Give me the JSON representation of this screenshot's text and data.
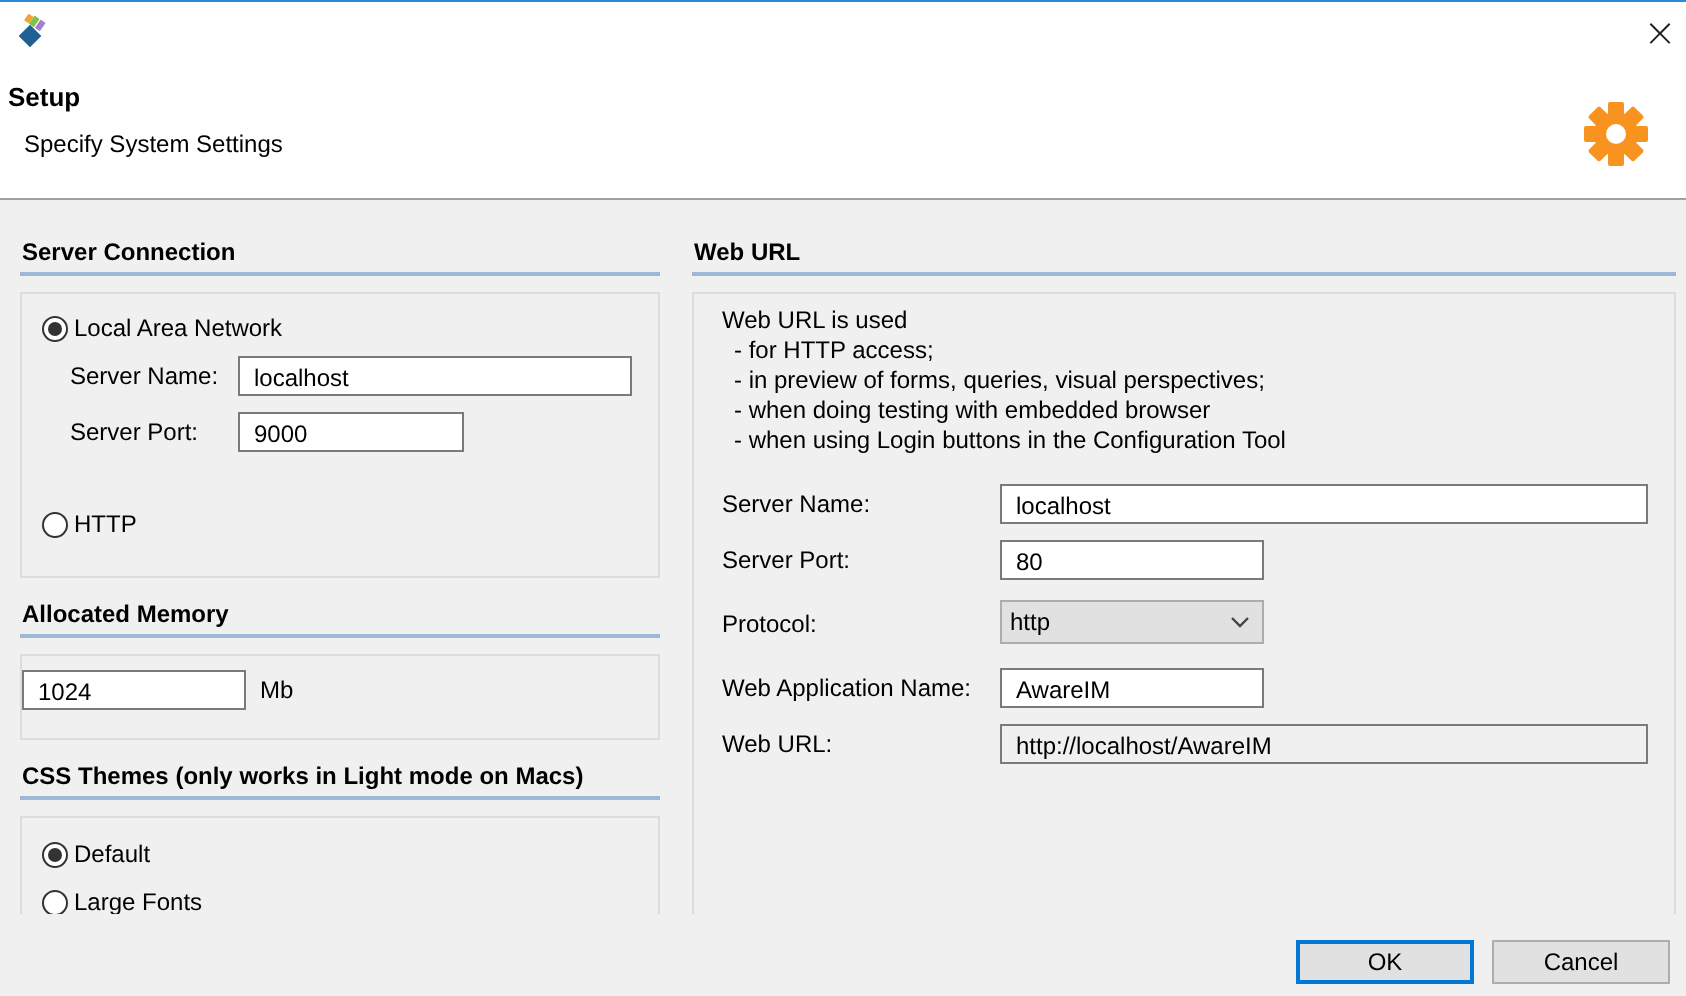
{
  "window": {
    "close": "×"
  },
  "header": {
    "title": "Setup",
    "subtitle": "Specify System Settings"
  },
  "left_sections": [
    {
      "title": "Server Connection",
      "items": [
        {
          "kind": "radio",
          "label": "Local Area Network",
          "selected": true
        },
        {
          "kind": "field",
          "label": "Server Name:",
          "value": "localhost"
        },
        {
          "kind": "short_field",
          "label": "Server Port:",
          "value": "9000"
        },
        {
          "kind": "radio",
          "label": "HTTP",
          "selected": false
        }
      ]
    },
    {
      "title": "Allocated Memory",
      "items": [
        {
          "kind": "unit_field",
          "value": "1024",
          "unit": "Mb"
        }
      ]
    },
    {
      "title": "CSS Themes (only works in Light mode on Macs)",
      "items": [
        {
          "kind": "radio",
          "label": "Default",
          "selected": true
        },
        {
          "kind": "radio",
          "label": "Large Fonts",
          "selected": false
        }
      ]
    }
  ],
  "right_sections": [
    {
      "title": "Web URL",
      "note": [
        "Web URL is used",
        "- for HTTP access;",
        "- in preview of forms, queries, visual perspectives;",
        "- when doing testing with embedded browser",
        "- when using Login buttons in the Configuration Tool"
      ],
      "items": [
        {
          "kind": "field",
          "label": "Server Name:",
          "value": "localhost"
        },
        {
          "kind": "short_field",
          "label": "Server Port:",
          "value": "80"
        },
        {
          "kind": "select",
          "label": "Protocol:",
          "value": "http"
        },
        {
          "kind": "short_field",
          "label": "Web Application Name:",
          "value": "AwareIM"
        },
        {
          "kind": "readonly_field",
          "label": "Web URL:",
          "value": "http://localhost/AwareIM"
        }
      ]
    }
  ],
  "buttons": [
    {
      "label": "OK",
      "default": true
    },
    {
      "label": "Cancel",
      "default": false
    }
  ]
}
